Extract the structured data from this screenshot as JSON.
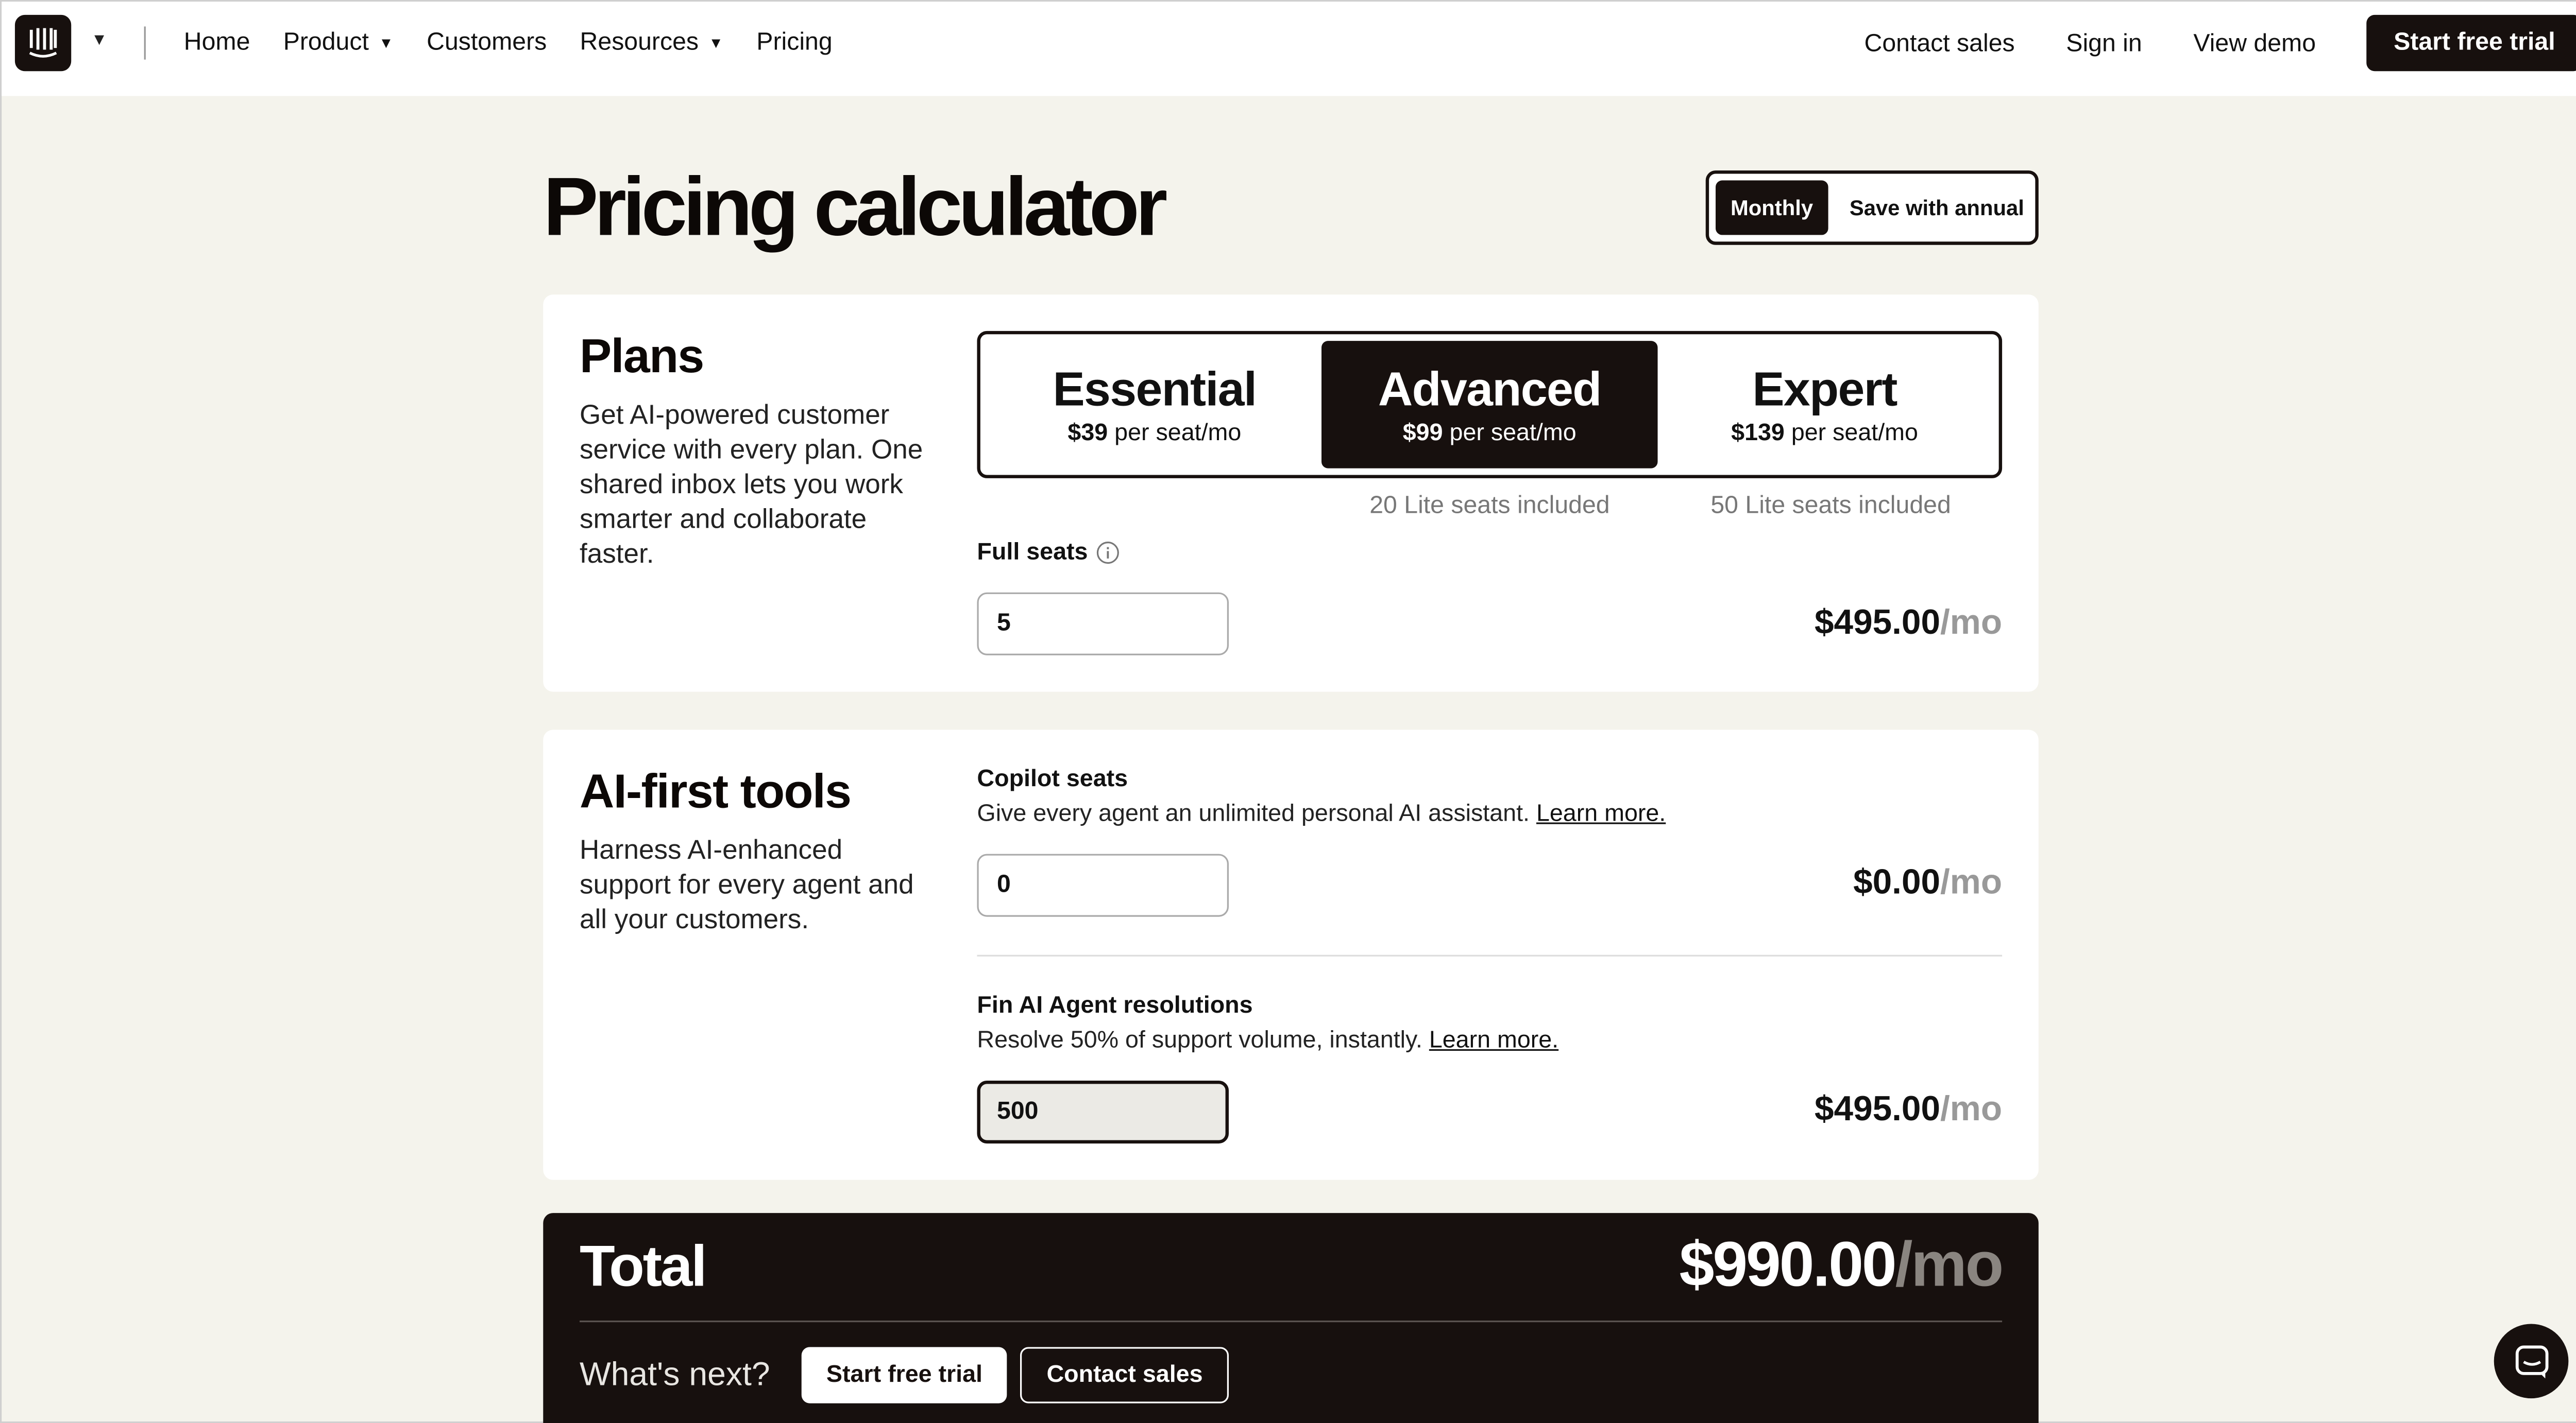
{
  "nav": {
    "links": [
      {
        "label": "Home",
        "has_caret": false
      },
      {
        "label": "Product",
        "has_caret": true
      },
      {
        "label": "Customers",
        "has_caret": false
      },
      {
        "label": "Resources",
        "has_caret": true
      },
      {
        "label": "Pricing",
        "has_caret": false
      }
    ],
    "contact_sales": "Contact sales",
    "sign_in": "Sign in",
    "view_demo": "View demo",
    "start_trial": "Start free trial",
    "logo_icon": "intercom-logo-icon"
  },
  "page": {
    "title": "Pricing calculator",
    "billing": {
      "monthly": "Monthly",
      "annual": "Save with annual",
      "selected": "Monthly"
    }
  },
  "plans": {
    "title": "Plans",
    "description": "Get AI-powered customer service with every plan. One shared inbox lets you work smarter and collaborate faster.",
    "options": [
      {
        "name": "Essential",
        "price": "$39",
        "unit": "per seat/mo",
        "lite": ""
      },
      {
        "name": "Advanced",
        "price": "$99",
        "unit": "per seat/mo",
        "lite": "20 Lite seats included"
      },
      {
        "name": "Expert",
        "price": "$139",
        "unit": "per seat/mo",
        "lite": "50 Lite seats included"
      }
    ],
    "selected": "Advanced",
    "full_seats_label": "Full seats",
    "full_seats_value": "5",
    "amount": "$495.00",
    "per": "/mo"
  },
  "ai_tools": {
    "title": "AI-first tools",
    "description": "Harness AI-enhanced support for every agent and all your customers.",
    "copilot": {
      "label": "Copilot seats",
      "subtitle": "Give every agent an unlimited personal AI assistant.",
      "learn_more": "Learn more.",
      "value": "0",
      "amount": "$0.00",
      "per": "/mo"
    },
    "fin": {
      "label": "Fin AI Agent resolutions",
      "subtitle": "Resolve 50% of support volume, instantly.",
      "learn_more": "Learn more.",
      "value": "500",
      "amount": "$495.00",
      "per": "/mo"
    }
  },
  "total": {
    "title": "Total",
    "amount": "$990.00",
    "per": "/mo",
    "whats_next": "What's next?",
    "start_trial": "Start free trial",
    "contact_sales": "Contact sales"
  },
  "colors": {
    "brand_dark": "#17100e",
    "background": "#f4f3ec"
  }
}
